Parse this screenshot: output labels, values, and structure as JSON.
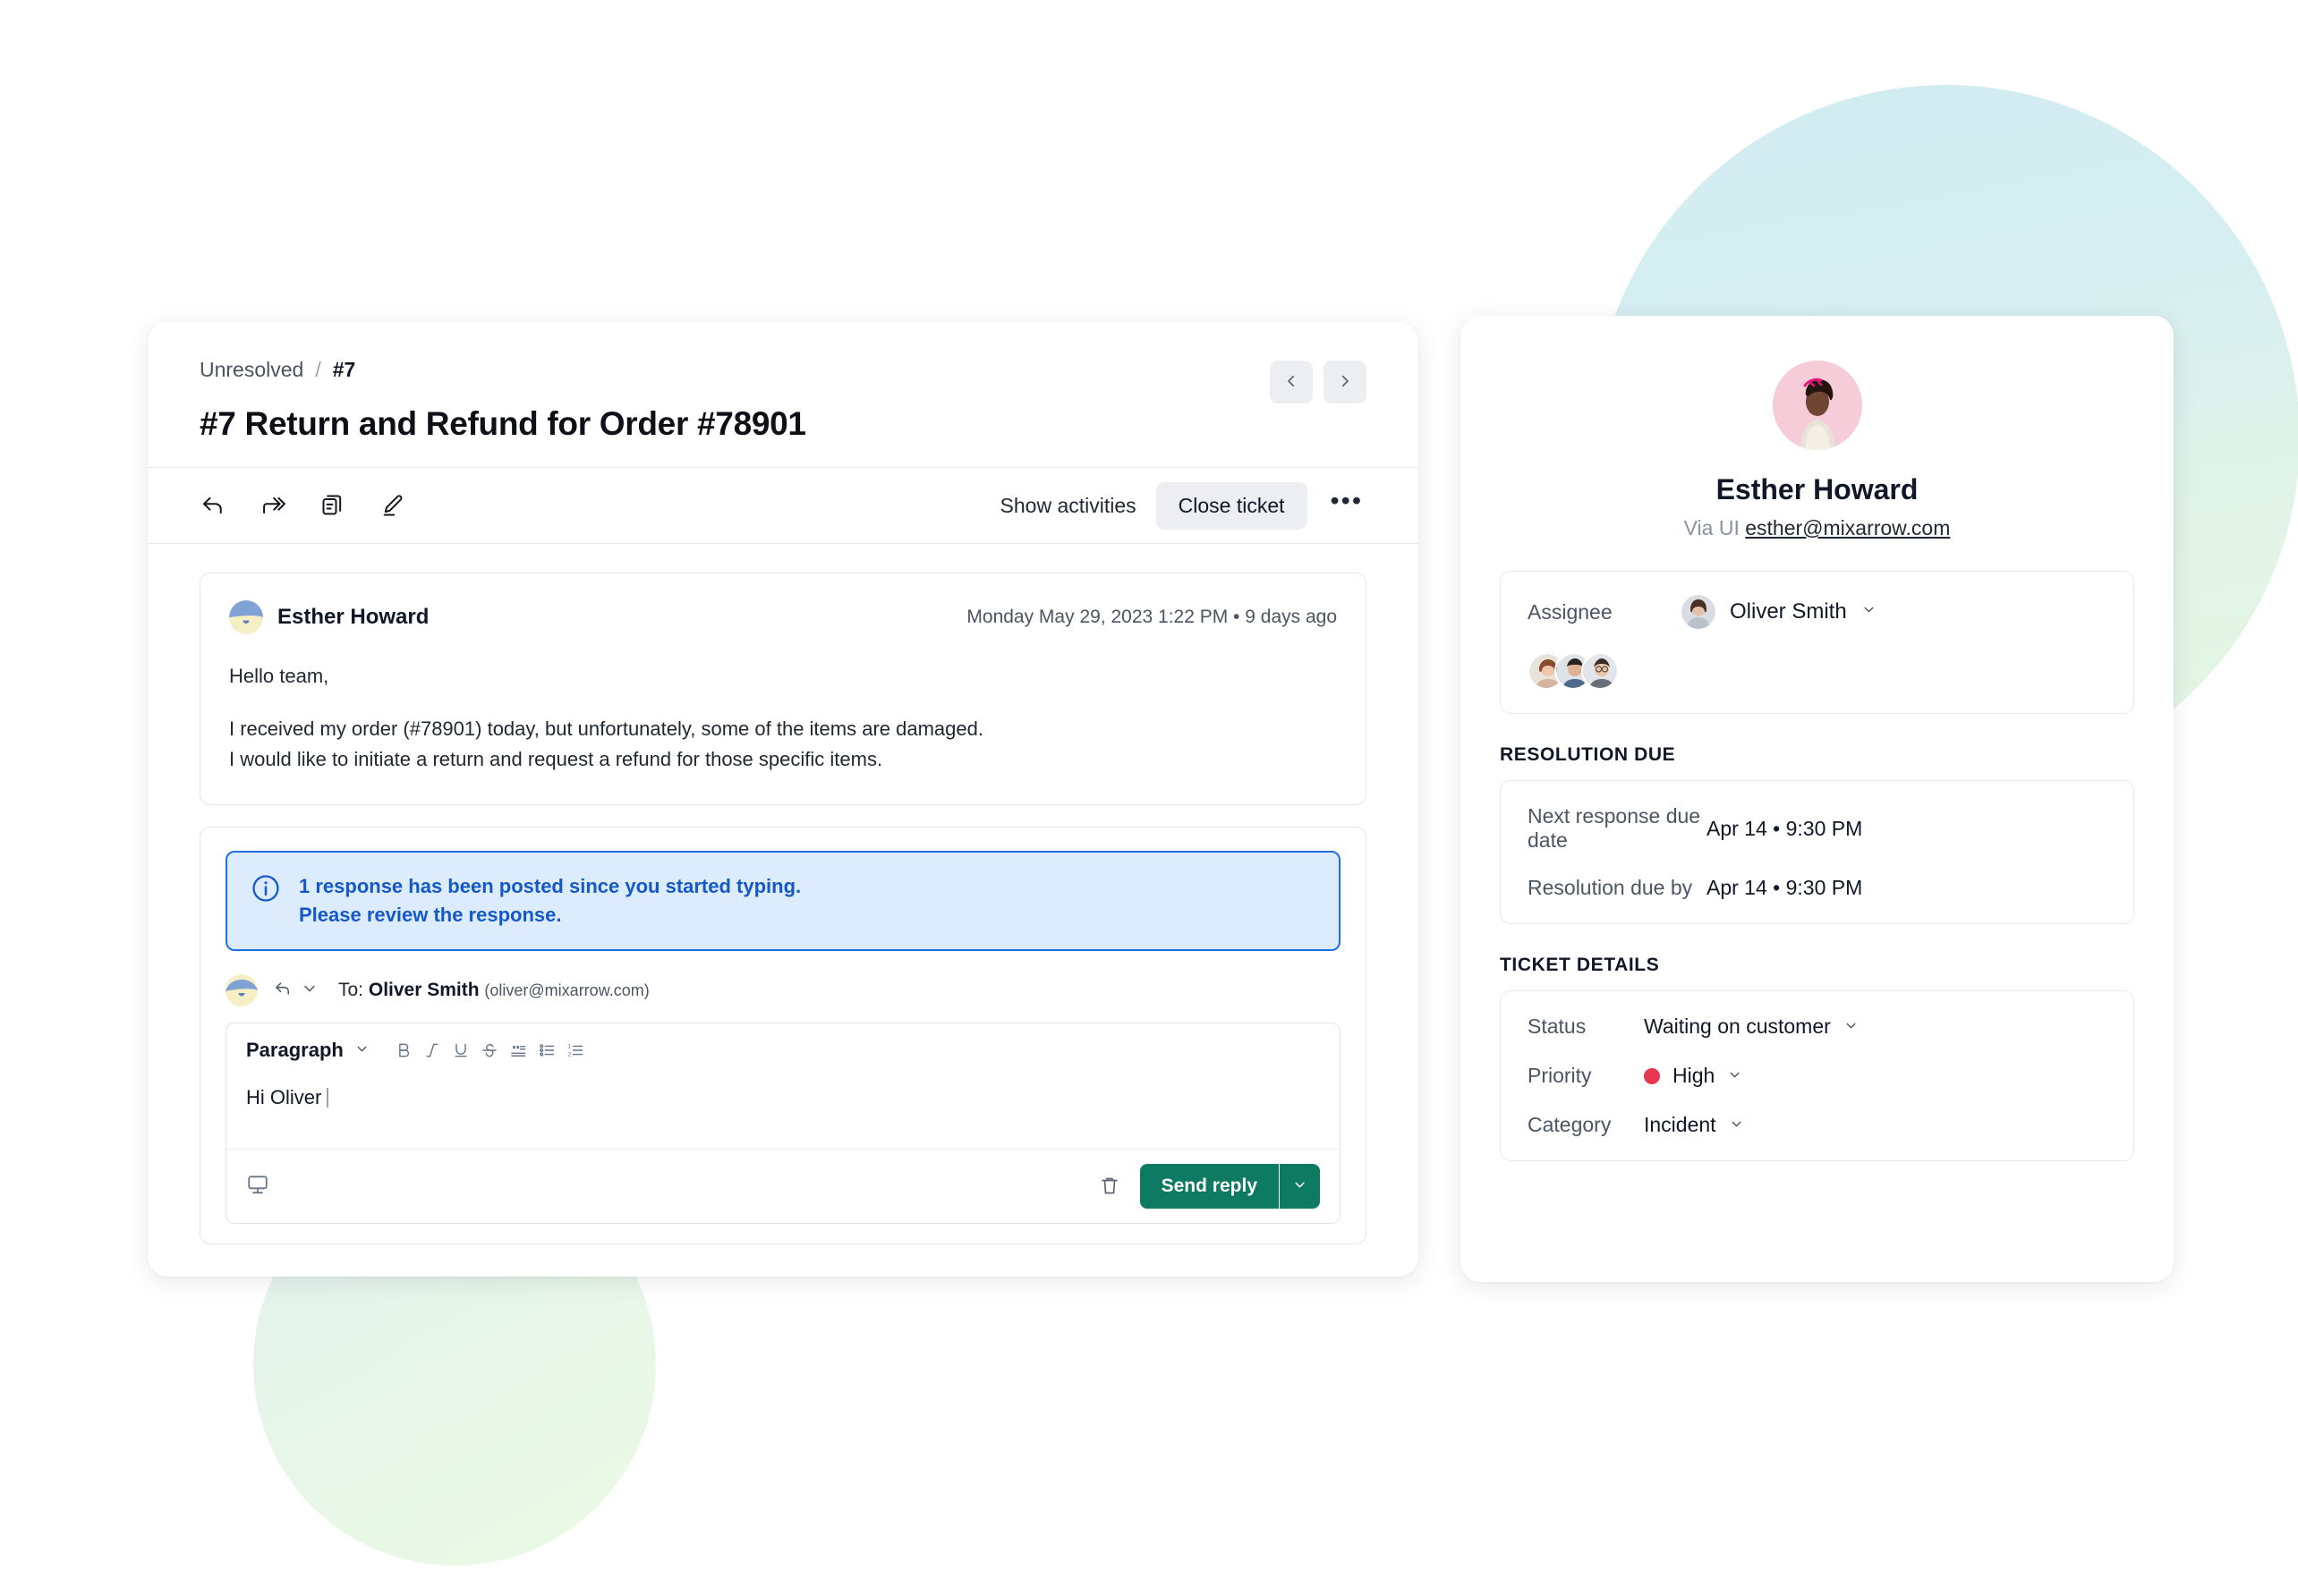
{
  "background": {
    "blob_top_right_colors": [
      "#cdeaf0",
      "#e3f7e0"
    ],
    "blob_bottom_left_colors": [
      "#dff0ec",
      "#e9fae0"
    ]
  },
  "ticket": {
    "breadcrumb": {
      "parent": "Unresolved",
      "separator": "/",
      "current": "#7"
    },
    "title": "#7 Return and Refund for Order #78901",
    "nav": {
      "prev_label": "Previous ticket",
      "next_label": "Next ticket"
    },
    "actions": {
      "reply_label": "Reply",
      "forward_label": "Forward",
      "note_label": "Add note",
      "edit_label": "Edit",
      "show_activities_label": "Show activities",
      "close_ticket_label": "Close ticket",
      "more_label": "•••"
    },
    "message": {
      "author": "Esther Howard",
      "timestamp": "Monday May 29, 2023 1:22 PM • 9 days ago",
      "greeting": "Hello team,",
      "line1": "I received my order (#78901) today, but unfortunately, some of the items are damaged.",
      "line2": "I would like to initiate a return and request a refund for those specific items."
    },
    "reply": {
      "alert_line1": "1 response has been posted since you started typing.",
      "alert_line2": "Please review the response.",
      "alert_accent": "#1f6fe5",
      "alert_bg": "#dcecfd",
      "recipient_prefix": "To:",
      "recipient_name": "Oliver Smith",
      "recipient_email": "(oliver@mixarrow.com)",
      "toolbar": {
        "block_format": "Paragraph",
        "bold": "B",
        "italic": "I",
        "underline": "U",
        "strikethrough": "S",
        "quote": "Blockquote",
        "bullet_list": "Bulleted list",
        "numbered_list": "Numbered list"
      },
      "body_text": "Hi Oliver",
      "screen_share_label": "Screen",
      "discard_label": "Discard",
      "send_label": "Send reply",
      "send_more_label": "More send options",
      "send_color": "#0e7a62"
    }
  },
  "details": {
    "contact": {
      "name": "Esther Howard",
      "via_label": "Via UI",
      "email": "esther@mixarrow.com"
    },
    "assignee": {
      "label": "Assignee",
      "name": "Oliver Smith"
    },
    "resolution": {
      "section_title": "RESOLUTION DUE",
      "rows": [
        {
          "key": "Next response due date",
          "value": "Apr 14 • 9:30 PM"
        },
        {
          "key": "Resolution due by",
          "value": "Apr 14 • 9:30 PM"
        }
      ]
    },
    "ticket_details": {
      "section_title": "TICKET DETAILS",
      "status": {
        "key": "Status",
        "value": "Waiting on customer"
      },
      "priority": {
        "key": "Priority",
        "value": "High",
        "color": "#e8384f"
      },
      "category": {
        "key": "Category",
        "value": "Incident"
      }
    }
  }
}
